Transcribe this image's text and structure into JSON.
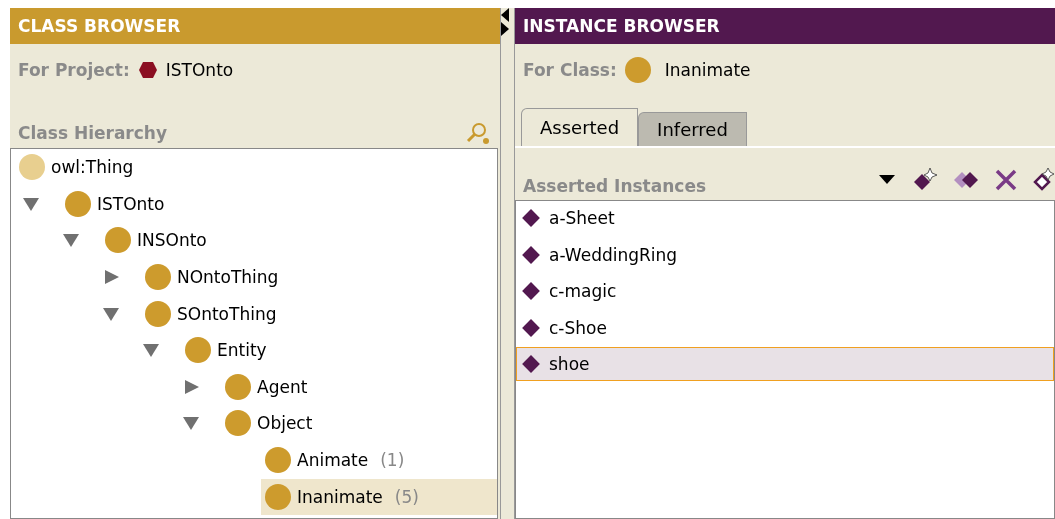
{
  "class_browser": {
    "title": "CLASS BROWSER",
    "project_label": "For Project:",
    "project_name": "ISTOnto",
    "hierarchy_label": "Class Hierarchy",
    "tree": [
      {
        "label": "owl:Thing",
        "kind": "root",
        "selected": false,
        "children": [
          {
            "label": "ISTOnto",
            "kind": "class",
            "expanded": true,
            "selected": false,
            "children": [
              {
                "label": "INSOnto",
                "kind": "class",
                "expanded": true,
                "selected": false,
                "children": [
                  {
                    "label": "NOntoThing",
                    "kind": "class",
                    "expanded": false,
                    "selected": false
                  },
                  {
                    "label": "SOntoThing",
                    "kind": "class",
                    "expanded": true,
                    "selected": false,
                    "children": [
                      {
                        "label": "Entity",
                        "kind": "class",
                        "expanded": true,
                        "selected": false,
                        "children": [
                          {
                            "label": "Agent",
                            "kind": "class",
                            "expanded": false,
                            "selected": false
                          },
                          {
                            "label": "Object",
                            "kind": "class",
                            "expanded": true,
                            "selected": false,
                            "children": [
                              {
                                "label": "Animate",
                                "kind": "class",
                                "count": "(1)",
                                "selected": false
                              },
                              {
                                "label": "Inanimate",
                                "kind": "class",
                                "count": "(5)",
                                "selected": true
                              }
                            ]
                          }
                        ]
                      }
                    ]
                  }
                ]
              }
            ]
          }
        ]
      }
    ]
  },
  "instance_browser": {
    "title": "INSTANCE BROWSER",
    "class_label": "For Class:",
    "class_name": "Inanimate",
    "tabs": [
      {
        "label": "Asserted",
        "selected": true
      },
      {
        "label": "Inferred",
        "selected": false
      }
    ],
    "list_label": "Asserted Instances",
    "instances": [
      {
        "label": "a-Sheet",
        "selected": false
      },
      {
        "label": "a-WeddingRing",
        "selected": false
      },
      {
        "label": "c-magic",
        "selected": false
      },
      {
        "label": "c-Shoe",
        "selected": false
      },
      {
        "label": "shoe",
        "selected": true
      }
    ]
  }
}
